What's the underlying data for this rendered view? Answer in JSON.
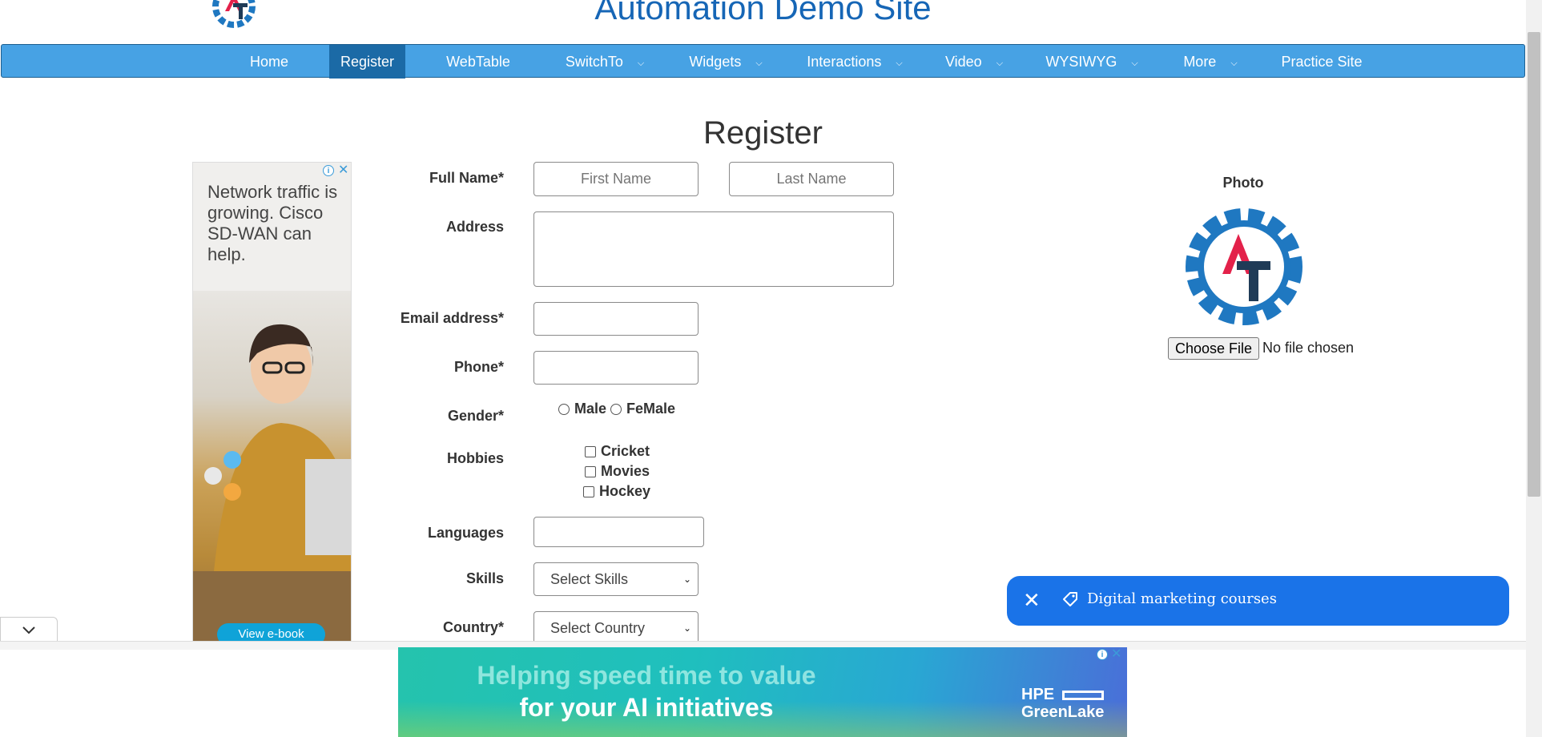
{
  "header": {
    "site_title": "Automation Demo Site"
  },
  "nav": {
    "items": [
      {
        "label": "Home"
      },
      {
        "label": "Register"
      },
      {
        "label": "WebTable"
      },
      {
        "label": "SwitchTo"
      },
      {
        "label": "Widgets"
      },
      {
        "label": "Interactions"
      },
      {
        "label": "Video"
      },
      {
        "label": "WYSIWYG"
      },
      {
        "label": "More"
      },
      {
        "label": "Practice Site"
      }
    ],
    "active": "Register",
    "chevron": "⌵"
  },
  "form": {
    "title": "Register",
    "full_name_label": "Full Name*",
    "first_name_placeholder": "First Name",
    "last_name_placeholder": "Last Name",
    "address_label": "Address",
    "address_value": "",
    "email_label": "Email address*",
    "email_value": "",
    "phone_label": "Phone*",
    "phone_value": "",
    "gender_label": "Gender*",
    "gender_options": [
      "Male",
      "FeMale"
    ],
    "hobbies_label": "Hobbies",
    "hobbies_options": [
      "Cricket",
      "Movies",
      "Hockey"
    ],
    "languages_label": "Languages",
    "languages_value": "",
    "skills_label": "Skills",
    "skills_selected": "Select Skills",
    "country_label": "Country*",
    "country_selected": "Select Country"
  },
  "photo": {
    "label": "Photo",
    "choose_button": "Choose File",
    "file_status": "No file chosen"
  },
  "ad_left": {
    "text": "Network traffic is growing. Cisco SD-WAN can help.",
    "button": "View e-book"
  },
  "ad_bottom": {
    "line1": "Helping speed time to value",
    "line2": "for your AI initiatives",
    "brand_line1": "HPE",
    "brand_line2": "GreenLake"
  },
  "toast": {
    "text": "Digital marketing courses"
  },
  "colors": {
    "brand_blue": "#1666b6",
    "nav_bg": "#47a2e4",
    "nav_active": "#1b6aa6",
    "logo_red": "#e3214a",
    "logo_dark": "#1f3b57",
    "toast_bg": "#1a73e8"
  }
}
